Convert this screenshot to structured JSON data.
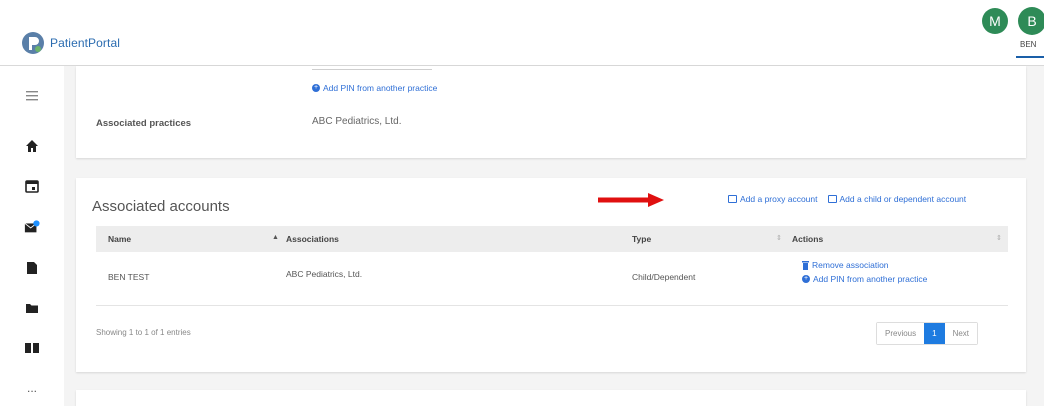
{
  "header": {
    "logo_text": "PatientPortal",
    "avatar_m": "M",
    "avatar_b": "B",
    "user_label": "BEN"
  },
  "sidebar": {
    "items": [
      "menu-icon",
      "home-icon",
      "calendar-icon",
      "messages-icon",
      "document-icon",
      "folder-icon",
      "book-icon",
      "more-icon"
    ],
    "more_label": "..."
  },
  "practices_card": {
    "add_pin_link": "Add PIN from another practice",
    "label": "Associated practices",
    "value": "ABC Pediatrics, Ltd."
  },
  "accounts": {
    "title": "Associated accounts",
    "add_proxy_link": "Add a proxy account",
    "add_child_link": "Add a child or dependent account",
    "columns": [
      "Name",
      "Associations",
      "Type",
      "Actions"
    ],
    "rows": [
      {
        "name": "BEN TEST",
        "associations": "ABC Pediatrics, Ltd.",
        "type": "Child/Dependent",
        "actions": [
          "Remove association",
          "Add PIN from another practice"
        ]
      }
    ],
    "showing_text": "Showing 1 to 1 of 1 entries",
    "pager": {
      "previous": "Previous",
      "current": "1",
      "next": "Next"
    }
  },
  "colors": {
    "link": "#2f6fd6",
    "arrow": "#e01010",
    "avatar": "#2e8b57",
    "page_active": "#1e7be0"
  }
}
